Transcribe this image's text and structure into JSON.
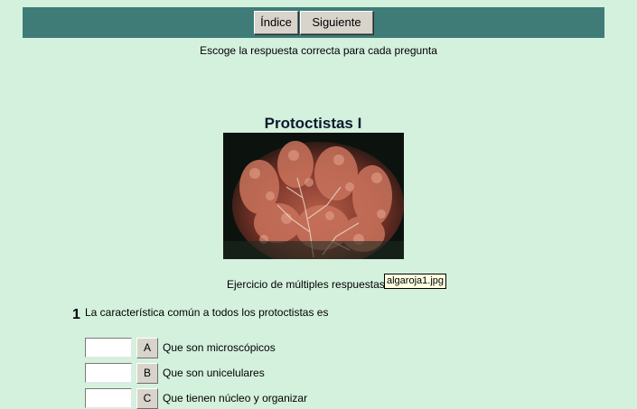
{
  "toolbar": {
    "index_label": "Índice",
    "next_label": "Siguiente"
  },
  "instructions": "Escoge la respuesta correcta para cada pregunta",
  "title": "Protoctistas I",
  "subtitle": "Ejercicio de múltiples respuestas",
  "tooltip": "algaroja1.jpg",
  "question": {
    "number": "1",
    "text": "La característica común a todos los protoctistas es",
    "options": [
      {
        "letter": "A",
        "text": "Que son microscópicos"
      },
      {
        "letter": "B",
        "text": "Que son unicelulares"
      },
      {
        "letter": "C",
        "text": "Que tienen núcleo y organizar"
      }
    ]
  },
  "colors": {
    "background": "#d4f1dd",
    "toolbar": "#3f7c78",
    "title": "#0b1a2e"
  }
}
